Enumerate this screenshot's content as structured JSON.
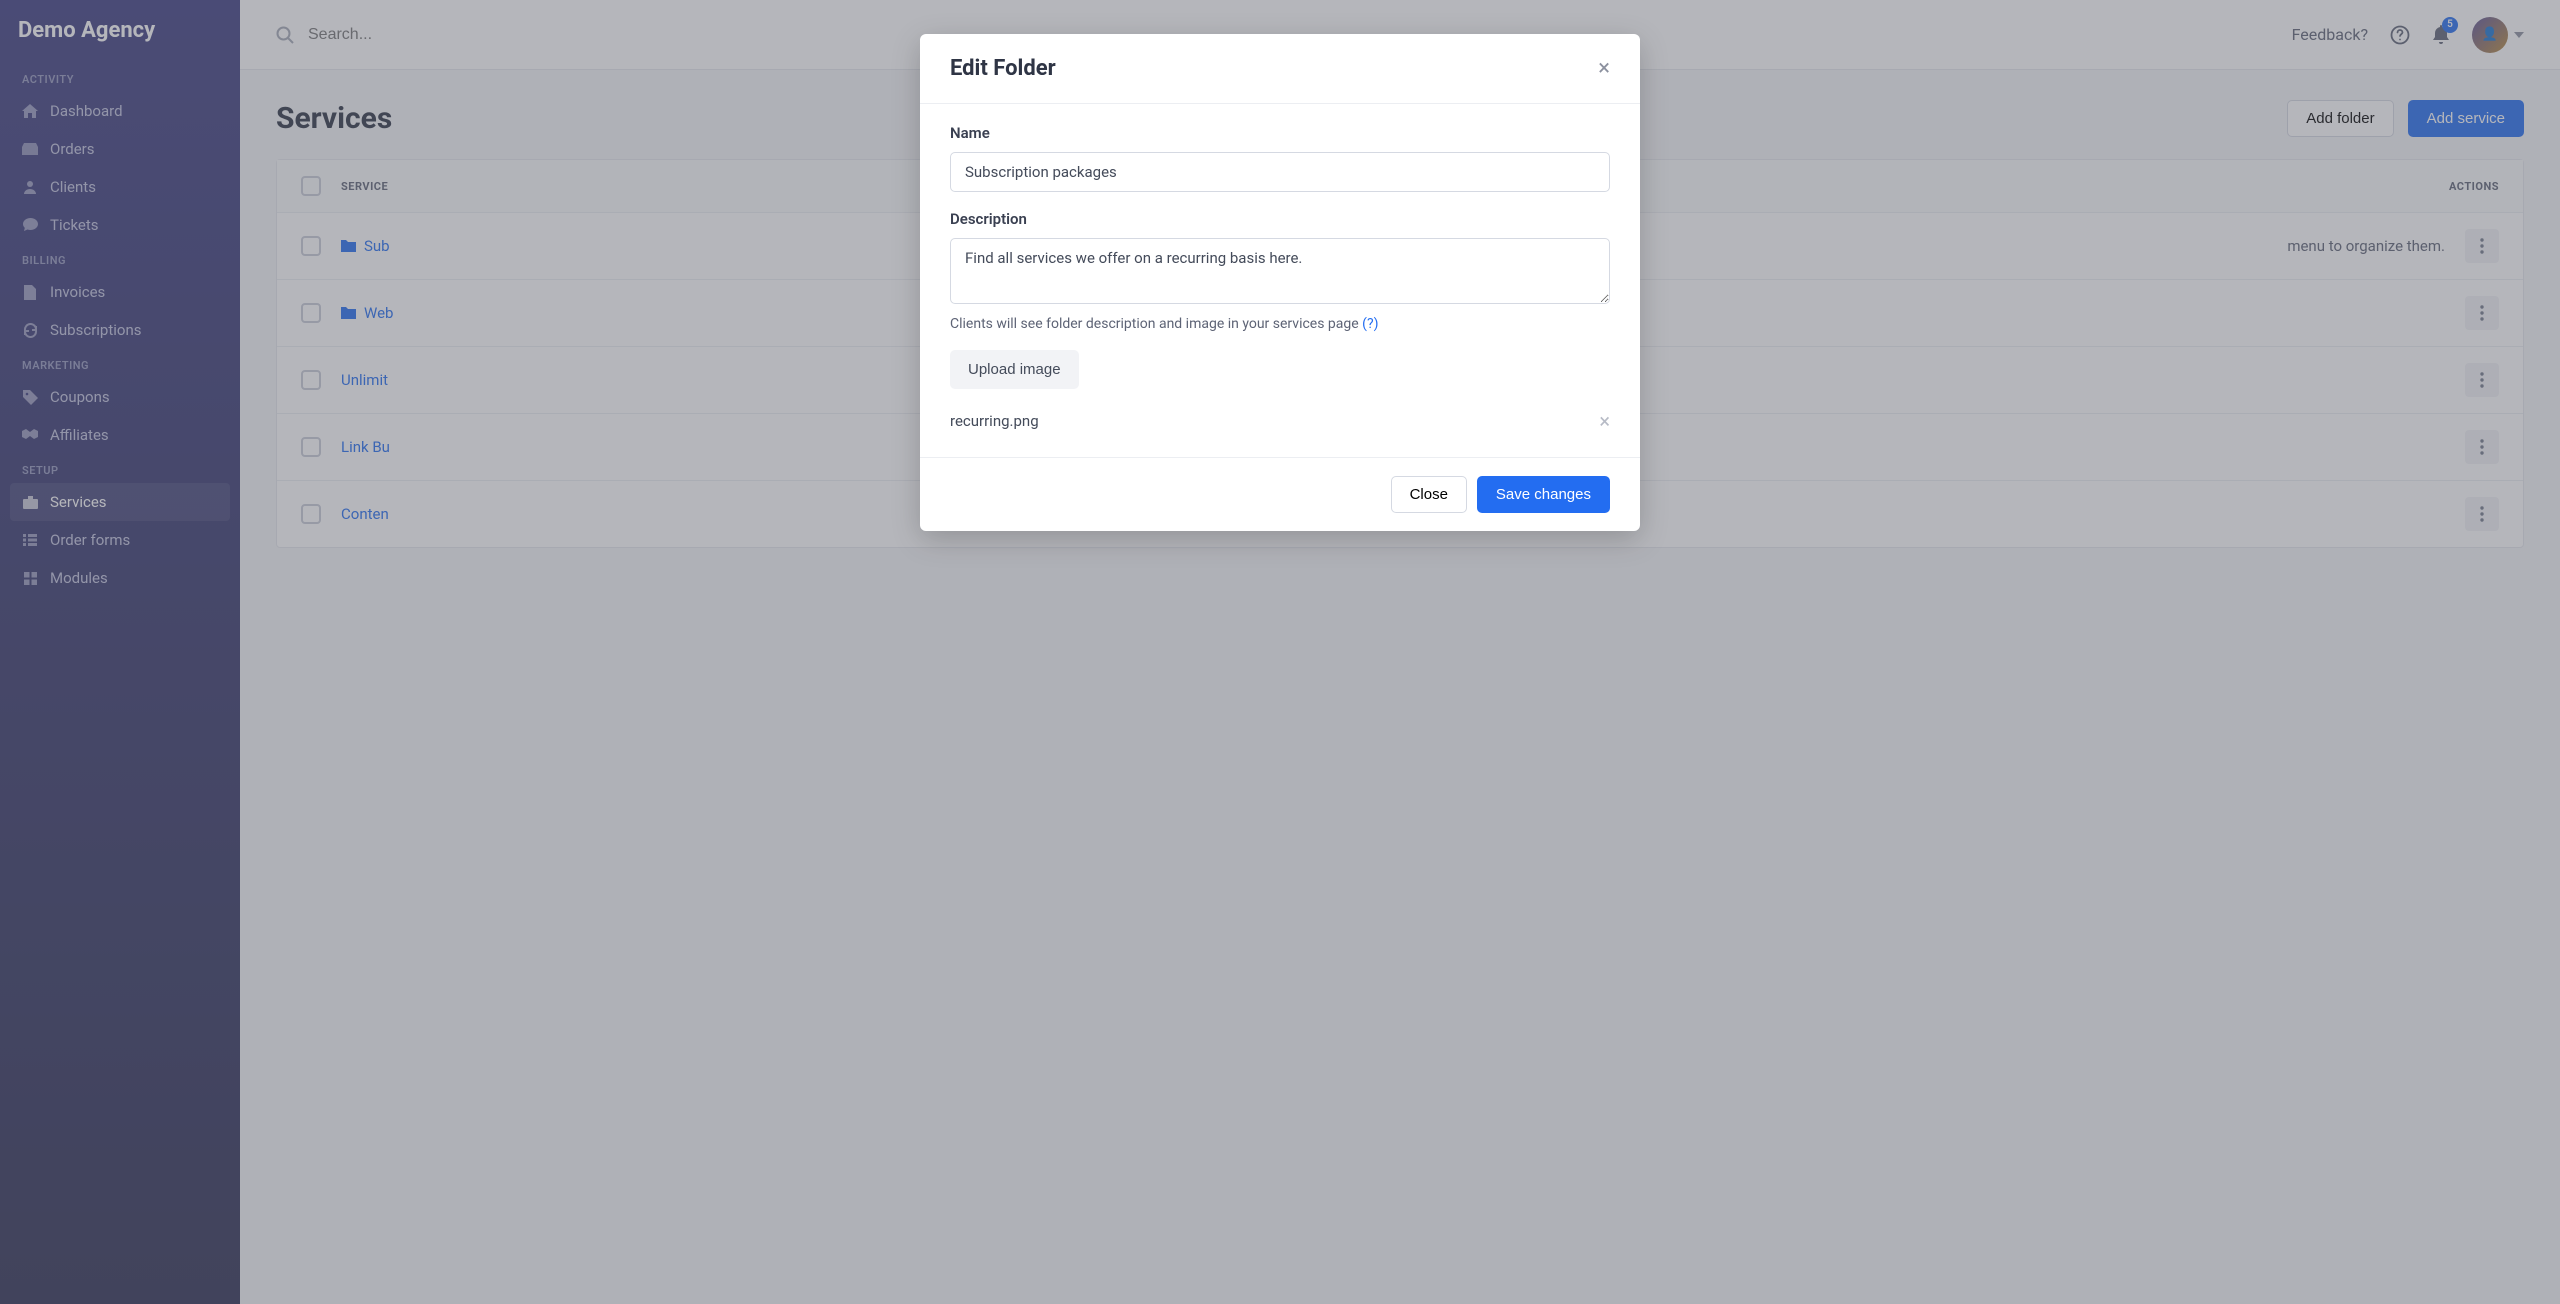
{
  "brand": "Demo Agency",
  "sidebar": {
    "sections": [
      {
        "label": "ACTIVITY"
      },
      {
        "label": "BILLING"
      },
      {
        "label": "MARKETING"
      },
      {
        "label": "SETUP"
      }
    ],
    "items": {
      "dashboard": "Dashboard",
      "orders": "Orders",
      "clients": "Clients",
      "tickets": "Tickets",
      "invoices": "Invoices",
      "subscriptions": "Subscriptions",
      "coupons": "Coupons",
      "affiliates": "Affiliates",
      "services": "Services",
      "order_forms": "Order forms",
      "modules": "Modules"
    }
  },
  "topbar": {
    "search_placeholder": "Search...",
    "feedback": "Feedback?",
    "badge_count": "5"
  },
  "page": {
    "title": "Services",
    "add_folder": "Add folder",
    "add_service": "Add service"
  },
  "table": {
    "header_service": "SERVICE",
    "header_actions": "ACTIONS",
    "rows": [
      {
        "name": "Sub",
        "is_folder": true,
        "hint": "menu to organize them."
      },
      {
        "name": "Web",
        "is_folder": true
      },
      {
        "name": "Unlimit"
      },
      {
        "name": "Link Bu"
      },
      {
        "name": "Conten"
      }
    ]
  },
  "modal": {
    "title": "Edit Folder",
    "name_label": "Name",
    "name_value": "Subscription packages",
    "description_label": "Description",
    "description_value": "Find all services we offer on a recurring basis here.",
    "helper_text": "Clients will see folder description and image in your services page ",
    "helper_link": "(?)",
    "upload_label": "Upload image",
    "filename": "recurring.png",
    "close_btn": "Close",
    "save_btn": "Save changes"
  }
}
